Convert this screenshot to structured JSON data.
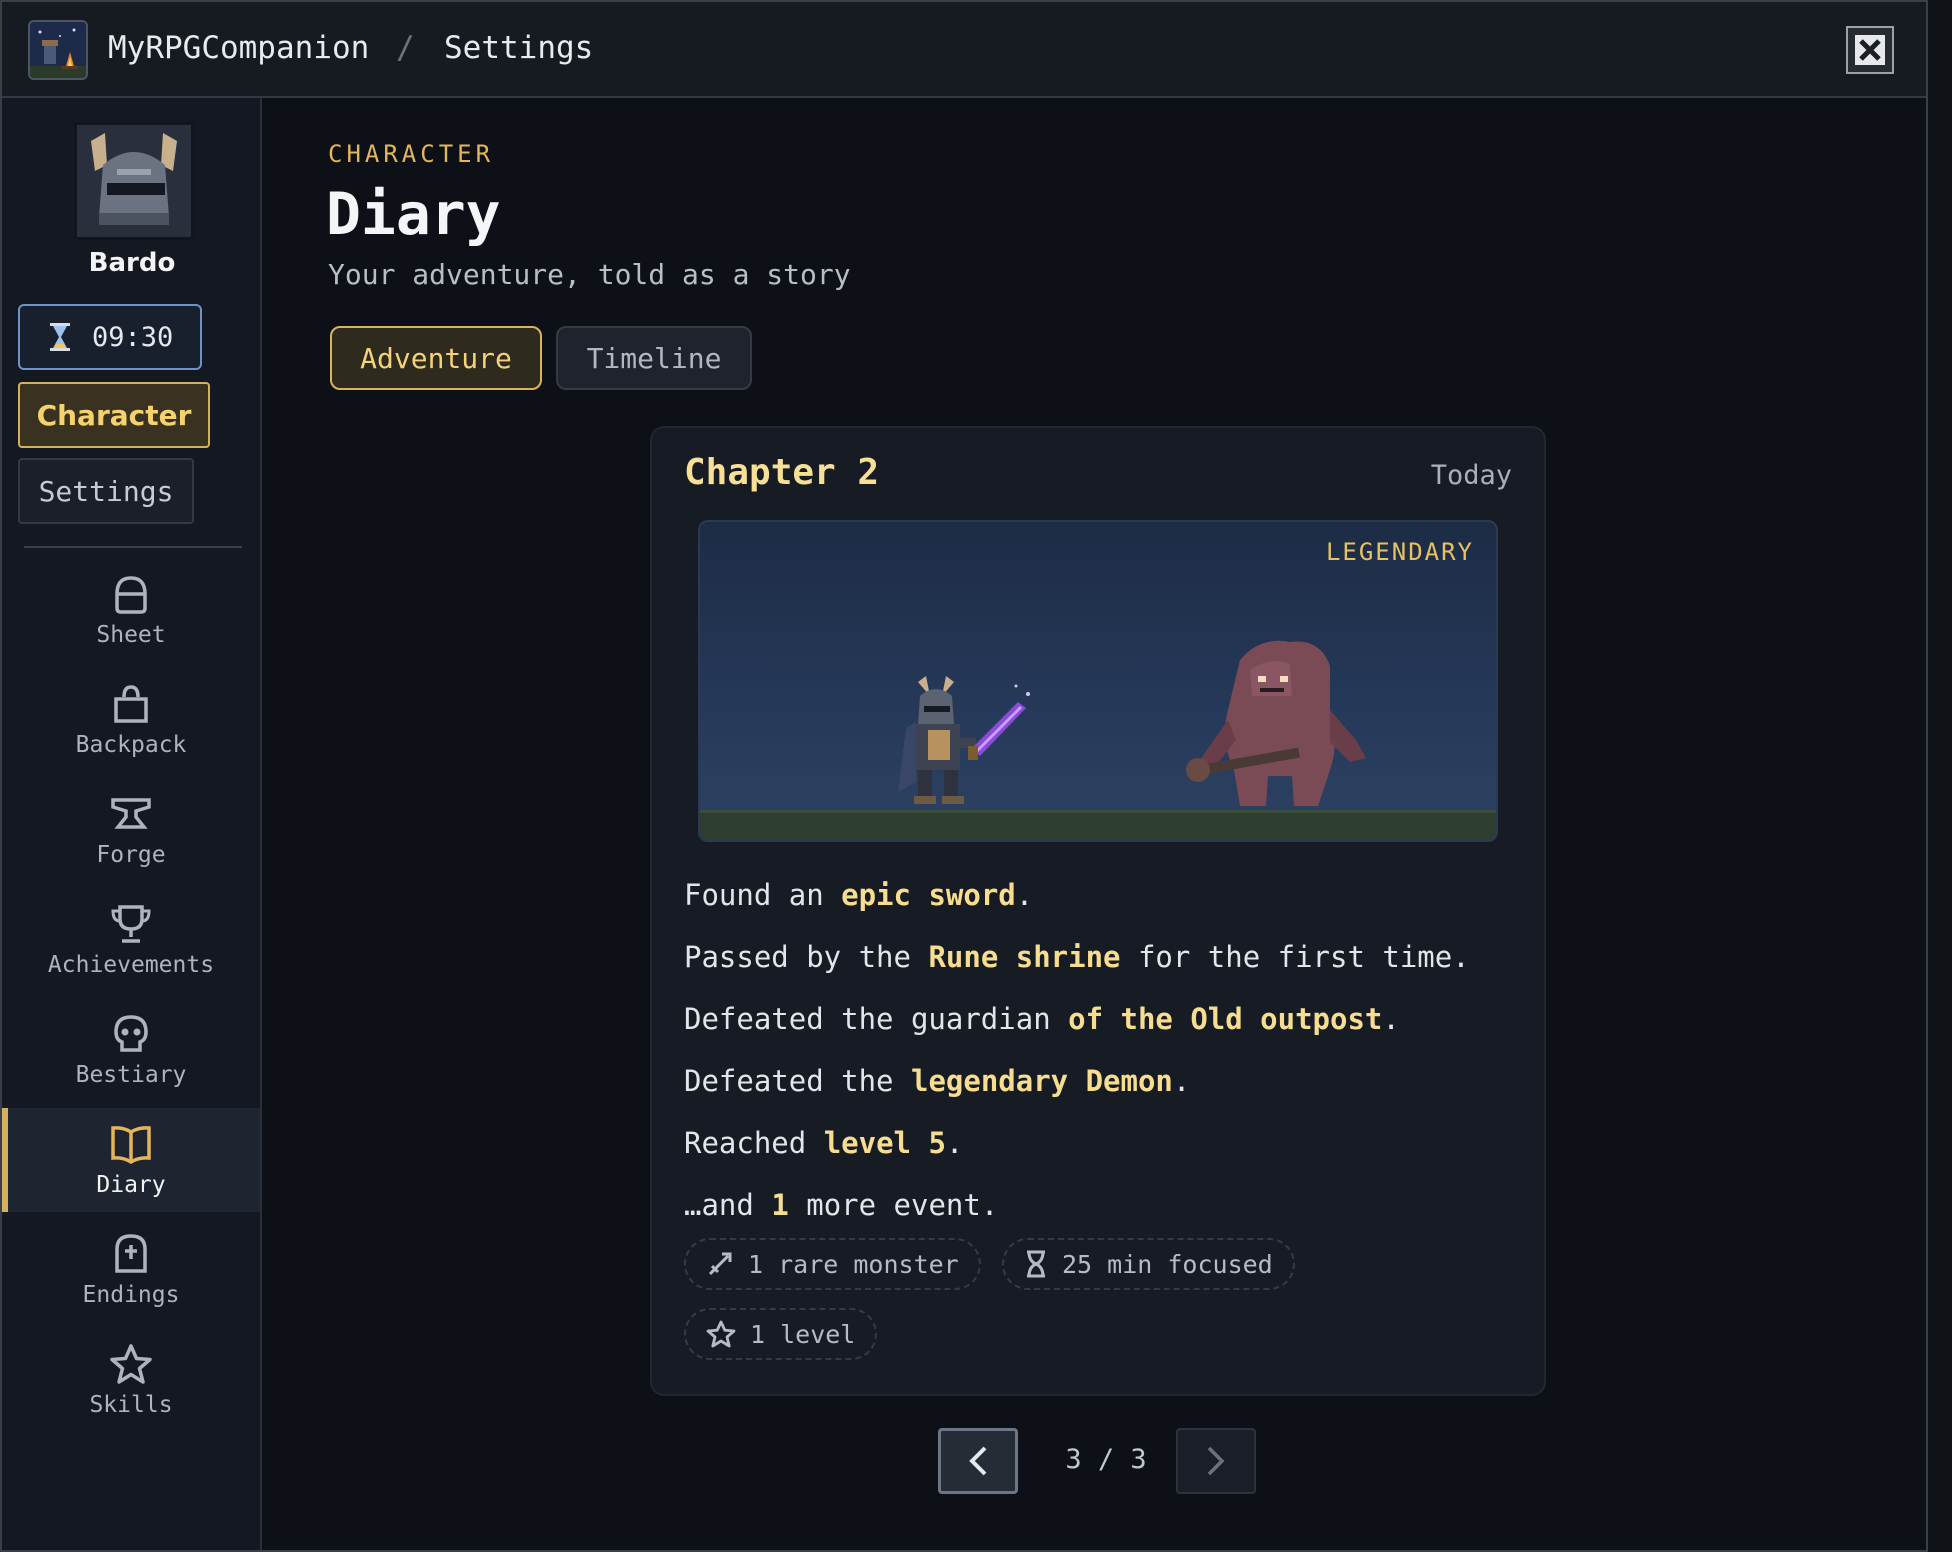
{
  "titlebar": {
    "app_name": "MyRPGCompanion",
    "separator": "/",
    "page": "Settings",
    "icons": {
      "app": "campfire-app-icon",
      "close": "close-icon"
    }
  },
  "sidebar": {
    "character_name": "Bardo",
    "timer": "09:30",
    "buttons": {
      "character": "Character",
      "settings": "Settings"
    },
    "nav": [
      {
        "label": "Sheet",
        "icon": "helmet-icon"
      },
      {
        "label": "Backpack",
        "icon": "backpack-icon"
      },
      {
        "label": "Forge",
        "icon": "anvil-icon"
      },
      {
        "label": "Achievements",
        "icon": "trophy-icon"
      },
      {
        "label": "Bestiary",
        "icon": "skull-icon"
      },
      {
        "label": "Diary",
        "icon": "book-icon",
        "active": true
      },
      {
        "label": "Endings",
        "icon": "tombstone-icon"
      },
      {
        "label": "Skills",
        "icon": "star-icon"
      }
    ]
  },
  "header": {
    "eyebrow": "CHARACTER",
    "title": "Diary",
    "subtitle": "Your adventure, told as a story"
  },
  "tabs": [
    {
      "label": "Adventure",
      "active": true
    },
    {
      "label": "Timeline",
      "active": false
    }
  ],
  "chapter": {
    "title": "Chapter 2",
    "date": "Today",
    "rarity": "LEGENDARY",
    "events": [
      {
        "before": "Found an ",
        "highlight": "epic sword",
        "after": "."
      },
      {
        "before": "Passed by the ",
        "highlight": "Rune shrine",
        "after": " for the first time."
      },
      {
        "before": "Defeated the guardian ",
        "highlight": "of the Old outpost",
        "after": "."
      },
      {
        "before": "Defeated the ",
        "highlight": "legendary Demon",
        "after": "."
      },
      {
        "before": "Reached ",
        "highlight": "level 5",
        "after": "."
      },
      {
        "before": "…and ",
        "highlight": "1",
        "after": " more event."
      }
    ],
    "chips": [
      {
        "label": "1 rare monster",
        "icon": "sword-icon"
      },
      {
        "label": "25 min focused",
        "icon": "hourglass-icon"
      },
      {
        "label": "1 level",
        "icon": "star-outline-icon"
      }
    ]
  },
  "pager": {
    "current": "3",
    "separator": "/",
    "total": "3",
    "text": "3 / 3"
  },
  "colors": {
    "accent": "#d4b15a",
    "highlight": "#f6dd8f",
    "background": "#0d1016"
  }
}
